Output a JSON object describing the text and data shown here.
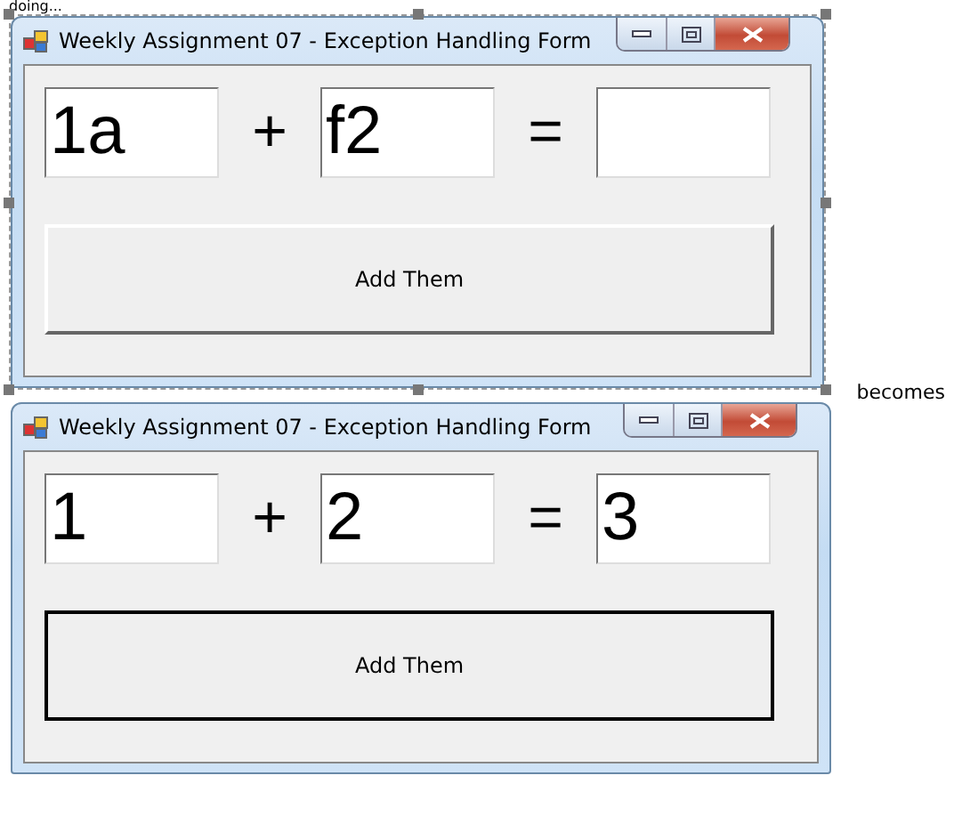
{
  "caption_top": "doing...",
  "windows": [
    {
      "title": "Weekly Assignment 07 - Exception Handling Form",
      "selected": true,
      "row": [
        {
          "kind": "field",
          "value": "1a"
        },
        {
          "kind": "operator",
          "text": "+"
        },
        {
          "kind": "field",
          "value": "f2"
        },
        {
          "kind": "operator",
          "text": "="
        },
        {
          "kind": "field"
        }
      ],
      "button": {
        "label": "Add Them",
        "focused": false
      }
    },
    {
      "title": "Weekly Assignment 07 - Exception Handling Form",
      "selected": false,
      "row": [
        {
          "kind": "field",
          "value": "1"
        },
        {
          "kind": "operator",
          "text": "+"
        },
        {
          "kind": "field",
          "value": "2"
        },
        {
          "kind": "operator",
          "text": "="
        },
        {
          "kind": "field",
          "value": "3"
        }
      ],
      "button": {
        "label": "Add Them",
        "focused": true
      }
    }
  ],
  "between_label": "becomes"
}
